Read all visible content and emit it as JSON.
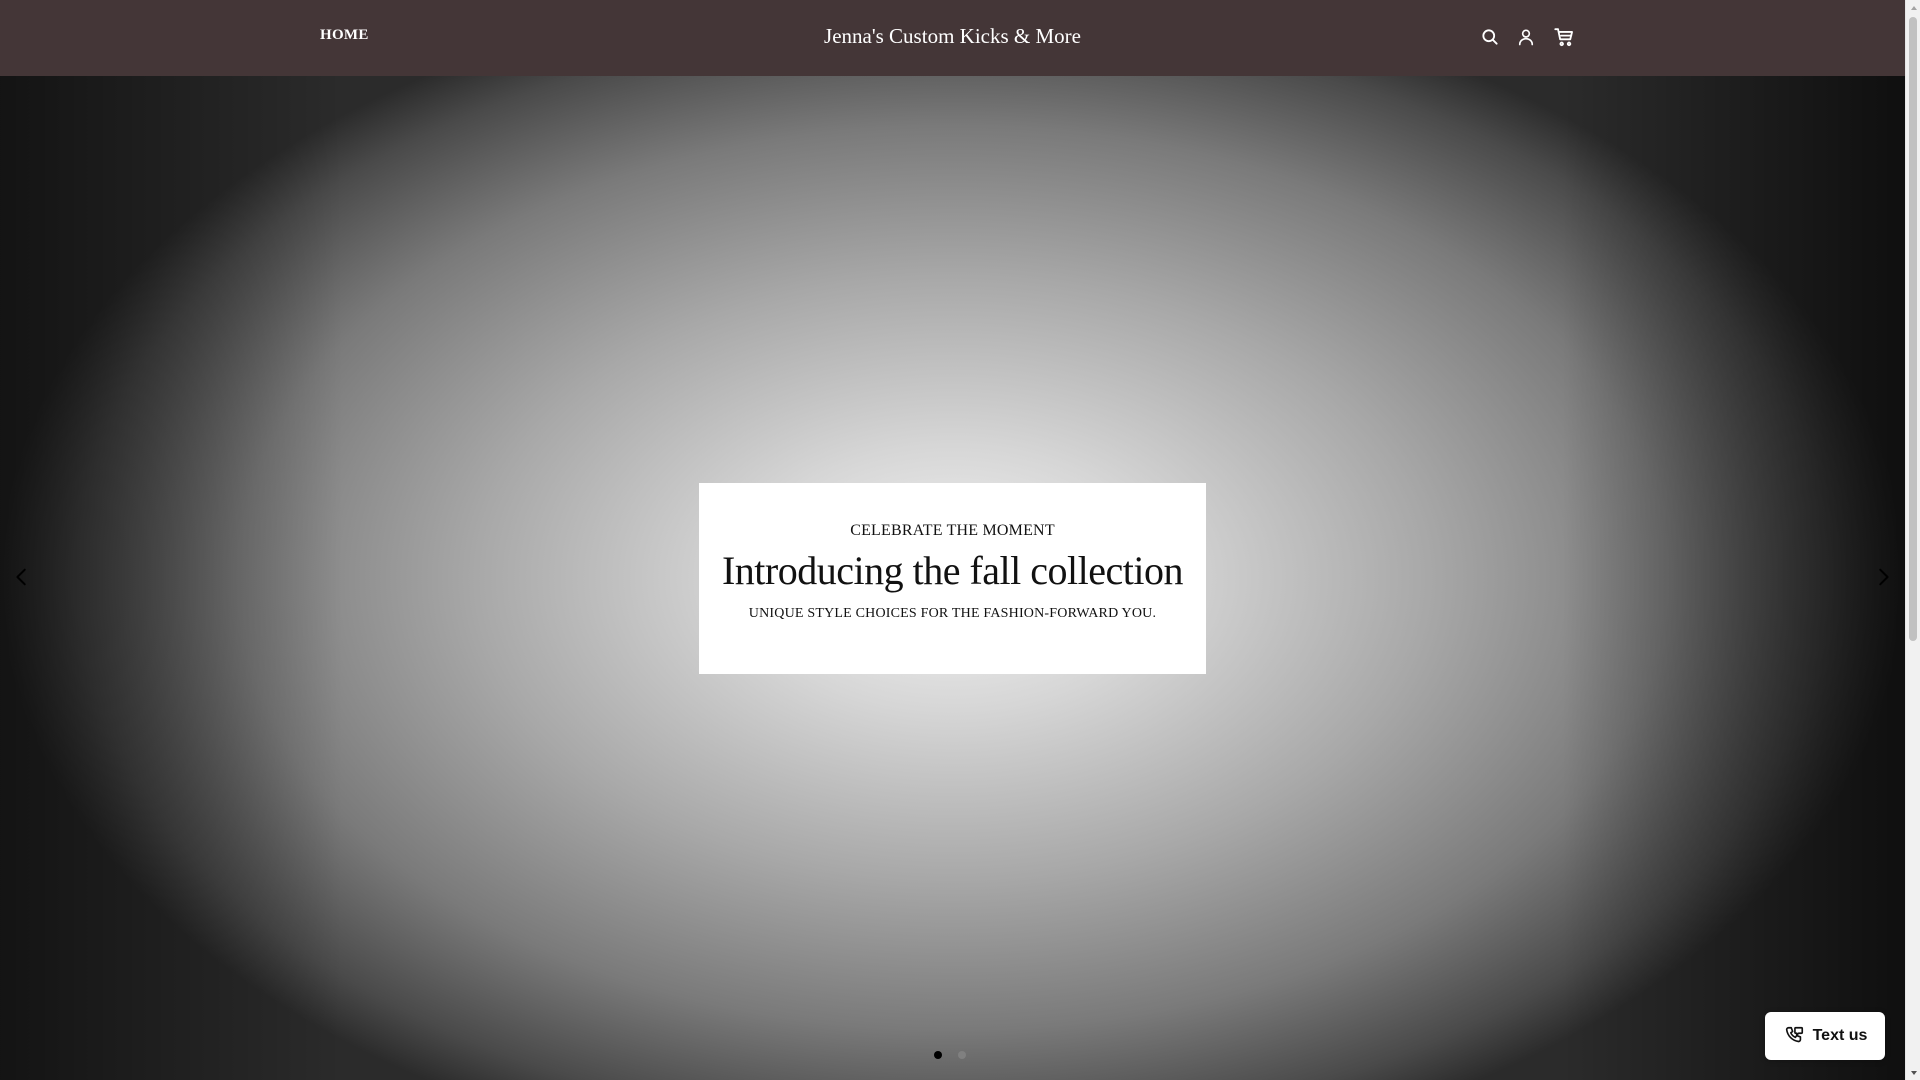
{
  "header": {
    "nav": [
      {
        "label": "HOME"
      }
    ],
    "store_title": "Jenna's Custom Kicks & More",
    "icons": {
      "search": "search-icon",
      "account": "account-icon",
      "cart": "cart-icon"
    },
    "background_color": "#443637"
  },
  "hero": {
    "eyebrow": "CELEBRATE THE MOMENT",
    "heading": "Introducing the fall collection",
    "subheading": "UNIQUE STYLE CHOICES FOR THE FASHION-FORWARD YOU.",
    "prev_icon": "chevron-left-icon",
    "next_icon": "chevron-right-icon",
    "slides_total": 2,
    "active_slide": 1
  },
  "chat_widget": {
    "label": "Text us",
    "icon": "message-phone-icon"
  }
}
